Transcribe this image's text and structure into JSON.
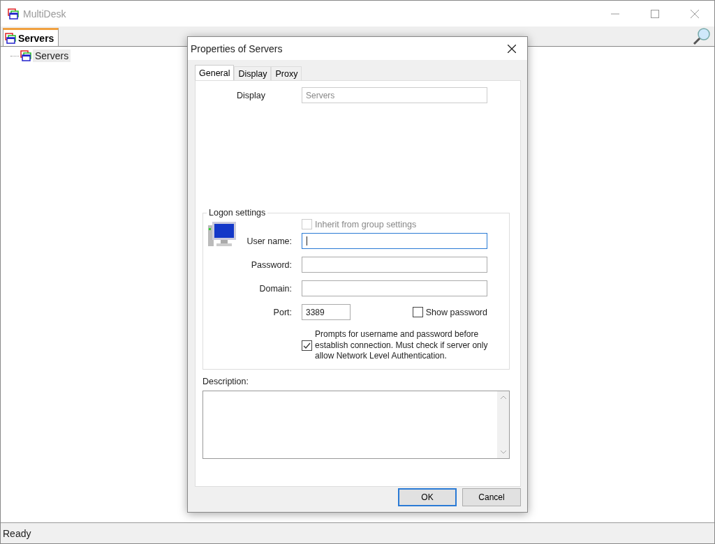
{
  "window": {
    "title": "MultiDesk"
  },
  "tabs": [
    {
      "label": "Servers",
      "selected": true
    }
  ],
  "tree": [
    {
      "label": "Servers",
      "selected": true
    }
  ],
  "dialog": {
    "title": "Properties of Servers",
    "tabs": [
      {
        "label": "General",
        "selected": true
      },
      {
        "label": "Display",
        "selected": false
      },
      {
        "label": "Proxy",
        "selected": false
      }
    ],
    "display_field": {
      "label": "Display",
      "value": "Servers",
      "disabled": true
    },
    "logon": {
      "title": "Logon settings",
      "inherit": {
        "label": "Inherit from group settings",
        "checked": false,
        "disabled": true
      },
      "fields": [
        {
          "label": "User name:",
          "focused": true
        },
        {
          "label": "Password:",
          "focused": false
        },
        {
          "label": "Domain:",
          "focused": false
        }
      ],
      "port": {
        "label": "Port:",
        "value": "3389"
      },
      "show_password": {
        "label": "Show password",
        "checked": false
      },
      "nla_prompt": {
        "label": "Prompts for username and password before establish connection. Must check if server only allow Network Level Authentication.",
        "checked": true
      }
    },
    "description": {
      "label": "Description:"
    },
    "buttons": [
      {
        "label": "OK",
        "default": true
      },
      {
        "label": "Cancel",
        "default": false
      }
    ]
  },
  "status_bar": "Ready"
}
